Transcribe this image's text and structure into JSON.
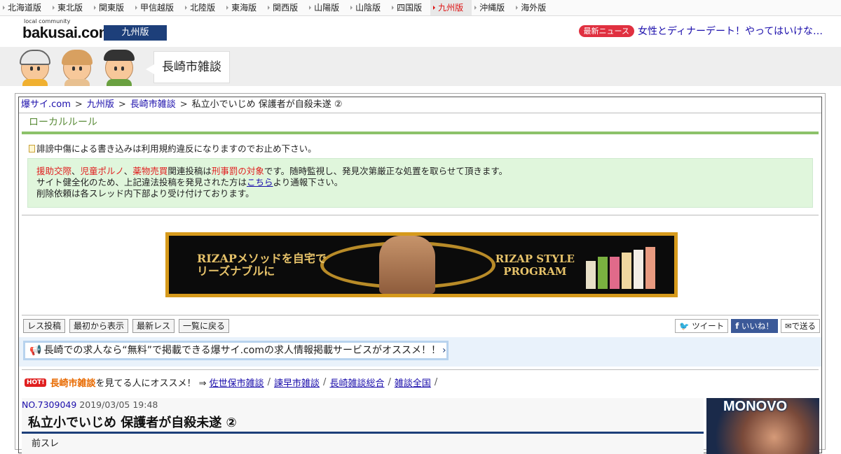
{
  "topnav": [
    {
      "label": "北海道版"
    },
    {
      "label": "東北版"
    },
    {
      "label": "関東版"
    },
    {
      "label": "甲信越版"
    },
    {
      "label": "北陸版"
    },
    {
      "label": "東海版"
    },
    {
      "label": "関西版"
    },
    {
      "label": "山陽版"
    },
    {
      "label": "山陰版"
    },
    {
      "label": "四国版"
    },
    {
      "label": "九州版",
      "active": true
    },
    {
      "label": "沖縄版"
    },
    {
      "label": "海外版"
    }
  ],
  "header": {
    "logo_sub": "local community",
    "logo": "bakusai.com",
    "region": "九州版",
    "news_badge": "最新ニュース",
    "news_text": "女性とディナーデート！やってはいけな…"
  },
  "banner": {
    "title": "長崎市雑談"
  },
  "breadcrumb": {
    "items": [
      "爆サイ.com",
      "九州版",
      "長崎市雑談"
    ],
    "sep": ">",
    "current": "私立小でいじめ 保護者が自殺未遂 ②"
  },
  "local_rule": {
    "heading": "ローカルルール",
    "warning": "誹謗中傷による書き込みは利用規約違反になりますのでお止め下さい。",
    "notice": {
      "r1": "援助交際",
      "c1": "、",
      "r2": "児童ポルノ",
      "c2": "、",
      "r3": "薬物売買",
      "t1": "関連投稿は",
      "r4": "刑事罰の対象",
      "t2": "です。随時監視し、発見次第厳正な処置を取らせて頂きます。",
      "line2_pre": "サイト健全化のため、上記違法投稿を発見された方は",
      "line2_link": "こちら",
      "line2_post": "より通報下さい。",
      "line3": "削除依頼は各スレッド内下部より受け付けております。"
    }
  },
  "ad": {
    "left_line1": "RIZAPメソッドを自宅で",
    "left_line2": "リーズナブルに",
    "right_line1": "RIZAP STYLE",
    "right_line2": "PROGRAM"
  },
  "actions": {
    "post": "レス投稿",
    "from_start": "最初から表示",
    "latest": "最新レス",
    "back": "一覧に戻る",
    "tweet": "ツイート",
    "like": "いいね！",
    "send": "で送る"
  },
  "recruit": {
    "text": "長崎での求人なら“無料”で掲載できる爆サイ.comの求人情報掲載サービスがオススメ！！"
  },
  "recommend": {
    "hot": "HOT!",
    "board": "長崎市雑談",
    "text": "を見てる人にオススメ！ ⇒",
    "links": [
      "佐世保市雑談",
      "諫早市雑談",
      "長崎雑談総合",
      "雑談全国"
    ],
    "sl": "/"
  },
  "thread": {
    "no": "NO.7309049",
    "date": "2019/03/05 19:48",
    "title": "私立小でいじめ 保護者が自殺未遂 ②",
    "body": "前スレ"
  },
  "side_ad": {
    "text": "MONOVO"
  }
}
